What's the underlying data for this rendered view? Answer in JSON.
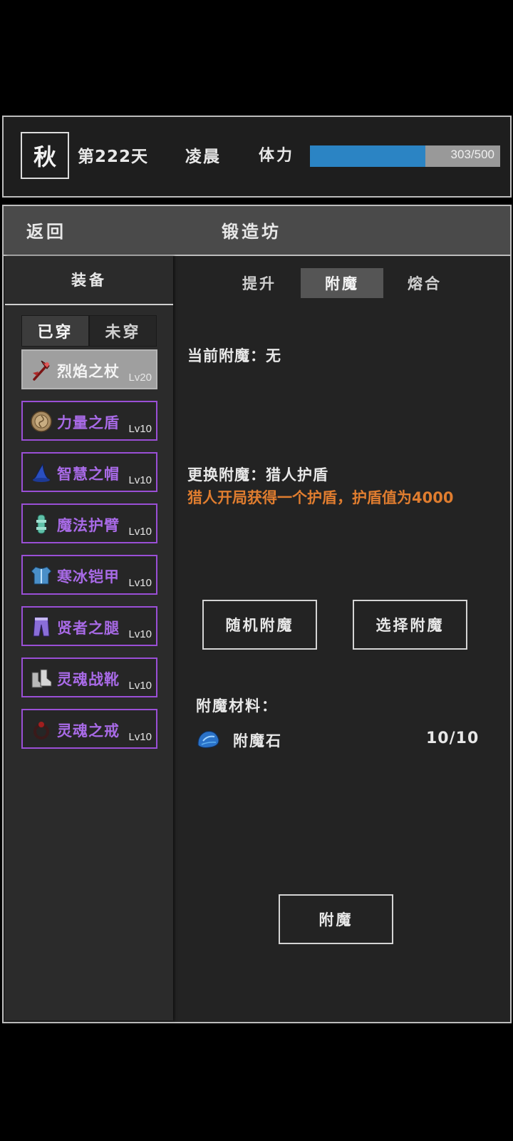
{
  "status": {
    "season": "秋",
    "day": "第222天",
    "time_of_day": "凌晨",
    "stamina_label": "体力",
    "stamina_value": "303/500",
    "stamina_fraction": 0.606
  },
  "header": {
    "back_label": "返回",
    "title": "锻造坊"
  },
  "sidebar": {
    "title": "装备",
    "tabs": [
      "已穿",
      "未穿"
    ],
    "items": [
      {
        "name": "烈焰之杖",
        "level": "Lv20",
        "icon": "staff-icon",
        "selected": true
      },
      {
        "name": "力量之盾",
        "level": "Lv10",
        "icon": "shield-icon"
      },
      {
        "name": "智慧之帽",
        "level": "Lv10",
        "icon": "hat-icon"
      },
      {
        "name": "魔法护臂",
        "level": "Lv10",
        "icon": "bracer-icon"
      },
      {
        "name": "寒冰铠甲",
        "level": "Lv10",
        "icon": "armor-icon"
      },
      {
        "name": "贤者之腿",
        "level": "Lv10",
        "icon": "leggings-icon"
      },
      {
        "name": "灵魂战靴",
        "level": "Lv10",
        "icon": "boots-icon"
      },
      {
        "name": "灵魂之戒",
        "level": "Lv10",
        "icon": "ring-icon"
      }
    ]
  },
  "content": {
    "tabs": [
      "提升",
      "附魔",
      "熔合"
    ],
    "active_tab": "附魔",
    "current_enchant": "当前附魔：无",
    "replace_enchant": "更换附魔：猎人护盾",
    "enchant_desc": "猎人开局获得一个护盾，护盾值为4000",
    "random_button": "随机附魔",
    "select_button": "选择附魔",
    "materials_label": "附魔材料：",
    "material": {
      "name": "附魔石",
      "count": "10/10",
      "icon": "enchant-stone-icon"
    },
    "enchant_button": "附魔"
  },
  "colors": {
    "accent_purple": "#9a4fd6",
    "stamina_blue": "#2b84c4",
    "desc_orange": "#e07d2f"
  }
}
